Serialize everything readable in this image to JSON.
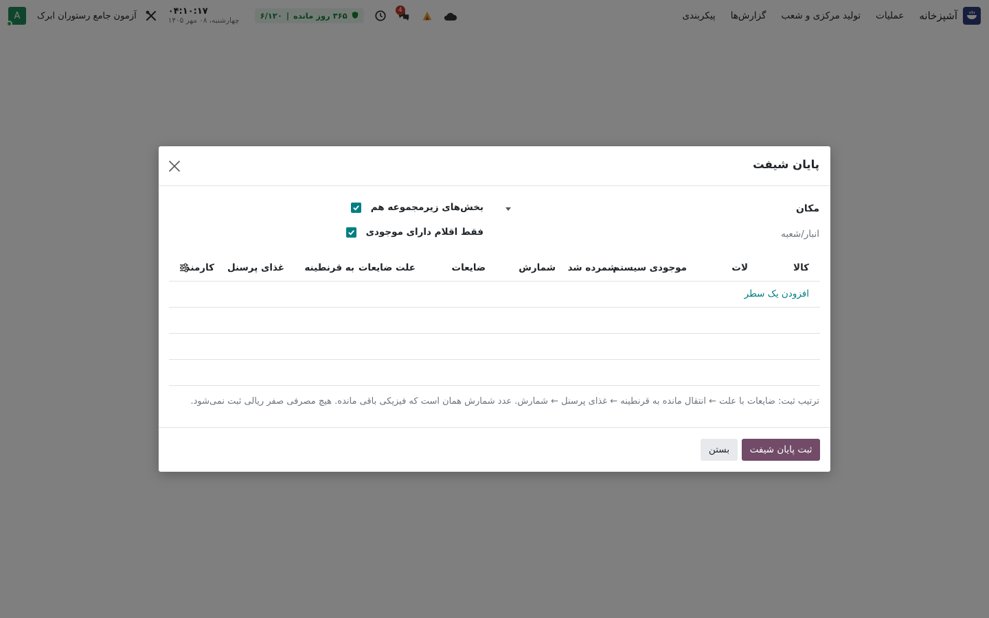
{
  "navbar": {
    "brand": "آشپزخانه",
    "menu": [
      "عملیات",
      "تولید مرکزی و شعب",
      "گزارش‌ها",
      "پیکربندی"
    ],
    "license": {
      "days": "۳۶۵ روز مانده",
      "count": "۶/۱۲۰"
    },
    "messages_badge": "4",
    "clock_time": "۰۴:۱۰:۱۷",
    "clock_date": "چهارشنبه، ۰۸ مهر ۱۴۰۵",
    "company": "آزمون جامع رستوران ابرک",
    "avatar_letter": "A"
  },
  "modal": {
    "title": "پایان شیفت",
    "location_label": "مکان",
    "location_value": "انبار/شعبه",
    "include_children_label": "بخش‌های زیرمجموعه هم",
    "only_stock_label": "فقط اقلام دارای موجودی",
    "columns": [
      "کالا",
      "لات",
      "موجودی سیستم",
      "شمرده شد",
      "شمارش",
      "ضایعات",
      "علت ضایعات",
      "به قرنطینه",
      "غذای پرسنل",
      "کارمند"
    ],
    "add_line": "افزودن یک سطر",
    "note": "ترتیب ثبت: ضایعات با علت ← انتقال مانده به قرنطینه ← غذای پرسنل ← شمارش. عدد شمارش همان است که فیزیکی باقی مانده. هیچ مصرفی صفر ریالی ثبت نمی‌شود.",
    "submit_label": "ثبت پایان شیفت",
    "close_label": "بستن"
  },
  "colors": {
    "primary": "#714b67",
    "accent": "#017e84",
    "license_green": "#1a7f37"
  }
}
